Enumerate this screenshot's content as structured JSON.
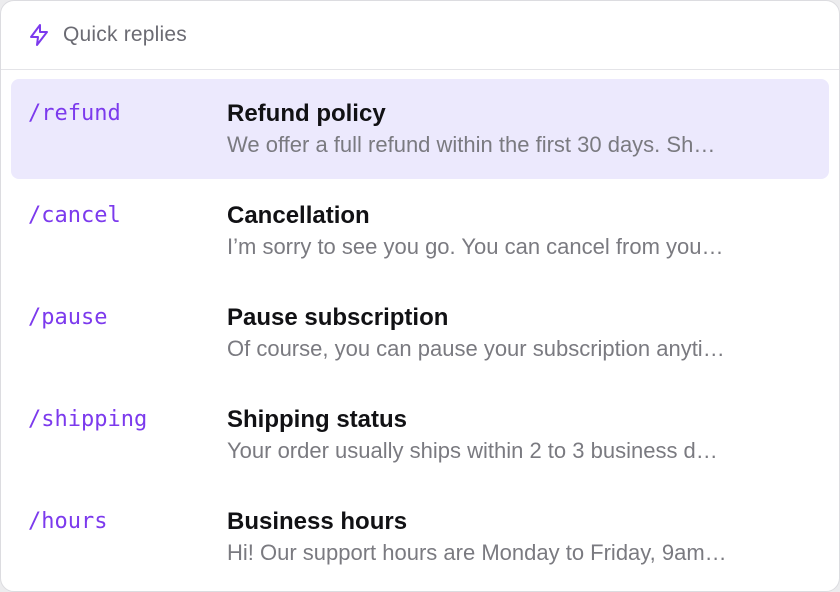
{
  "header": {
    "title": "Quick replies",
    "icon": "lightning-bolt-icon",
    "accent_color": "#7c3aed"
  },
  "items": [
    {
      "shortcut": "/refund",
      "title": "Refund policy",
      "preview": "We offer a full refund within the first 30 days. Sh…",
      "selected": true
    },
    {
      "shortcut": "/cancel",
      "title": "Cancellation",
      "preview": "I’m sorry to see you go. You can cancel from you…",
      "selected": false
    },
    {
      "shortcut": "/pause",
      "title": "Pause subscription",
      "preview": "Of course, you can pause your subscription anyti…",
      "selected": false
    },
    {
      "shortcut": "/shipping",
      "title": "Shipping status",
      "preview": "Your order usually ships within 2 to 3 business d…",
      "selected": false
    },
    {
      "shortcut": "/hours",
      "title": "Business hours",
      "preview": "Hi! Our support hours are Monday to Friday, 9am…",
      "selected": false
    }
  ]
}
